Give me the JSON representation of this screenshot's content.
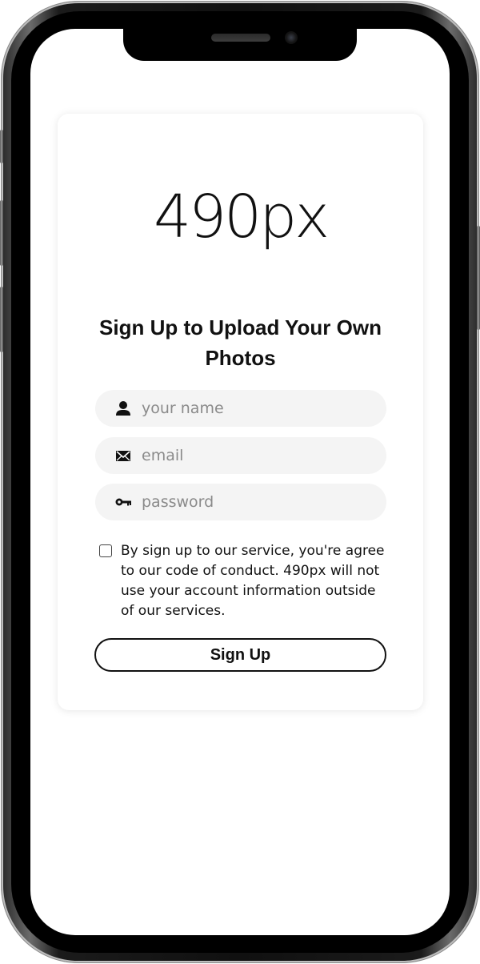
{
  "app": {
    "logo_text": "490px"
  },
  "signup": {
    "title": "Sign Up to Upload Your Own Photos",
    "fields": [
      {
        "icon": "user-icon",
        "placeholder": "your name",
        "value": ""
      },
      {
        "icon": "envelope-icon",
        "placeholder": "email",
        "value": ""
      },
      {
        "icon": "key-icon",
        "placeholder": "password",
        "value": ""
      }
    ],
    "terms": {
      "checked": false,
      "text": "By sign up to our service, you're agree to our code of conduct. 490px will not use your account information outside of our services."
    },
    "button_label": "Sign Up"
  },
  "colors": {
    "field_bg": "#f4f4f4",
    "text": "#111111",
    "placeholder": "#8a8a8a"
  }
}
